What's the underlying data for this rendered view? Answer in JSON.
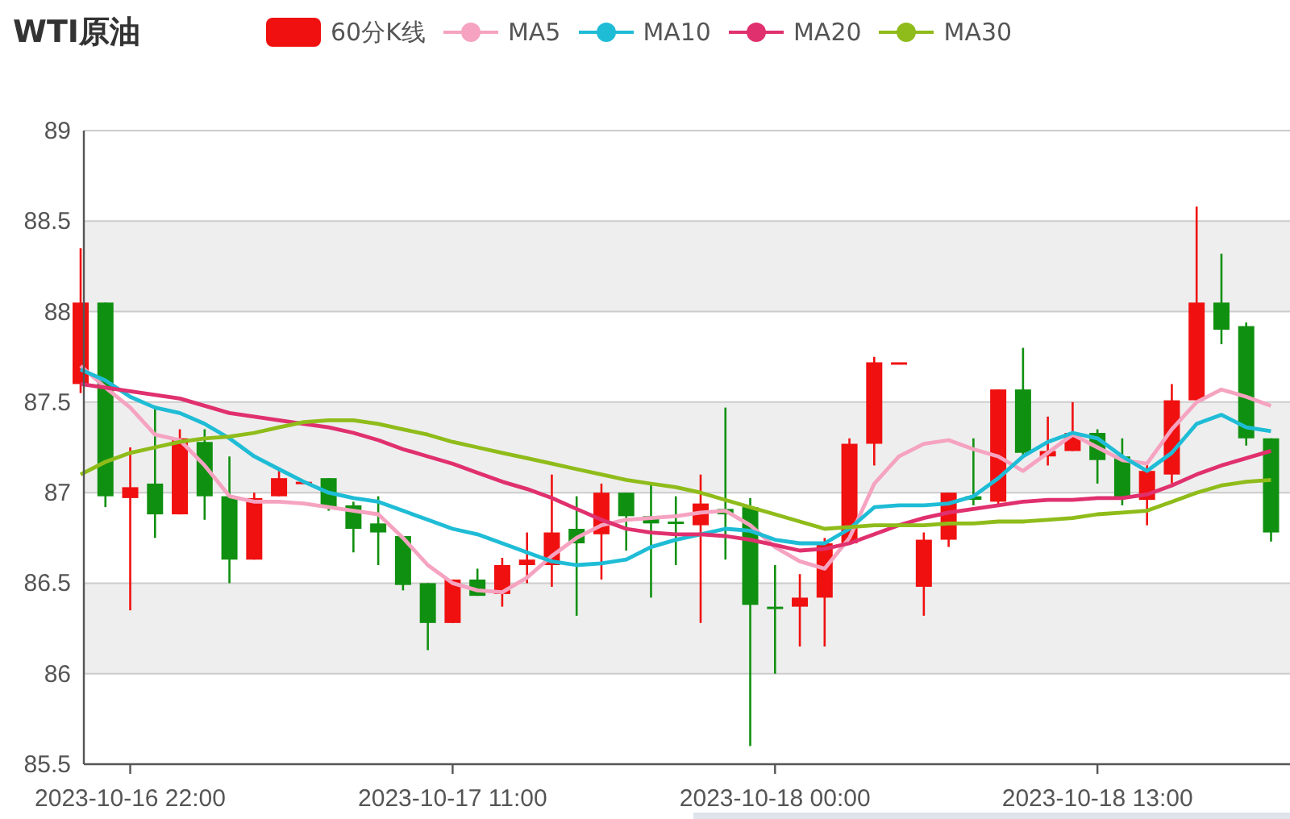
{
  "candle_legend": {
    "label": "60分K线",
    "color": "#f01010"
  },
  "chart_data": {
    "type": "candlestick",
    "title": "WTI原油",
    "ylim": [
      85.5,
      89
    ],
    "yticks": [
      85.5,
      86,
      86.5,
      87,
      87.5,
      88,
      88.5,
      89
    ],
    "grid": true,
    "legend": "top",
    "categories": [
      null,
      null,
      "2023-10-16 22:00",
      null,
      null,
      null,
      null,
      null,
      null,
      null,
      null,
      null,
      null,
      null,
      null,
      "2023-10-17 11:00",
      null,
      null,
      null,
      null,
      null,
      null,
      null,
      null,
      null,
      null,
      null,
      null,
      "2023-10-18 00:00",
      null,
      null,
      null,
      null,
      null,
      null,
      null,
      null,
      null,
      null,
      null,
      null,
      "2023-10-18 13:00",
      null,
      null,
      null,
      null,
      null,
      null,
      null
    ],
    "ohlc": [
      [
        87.6,
        88.35,
        87.55,
        88.05
      ],
      [
        88.05,
        88.05,
        86.92,
        86.98
      ],
      [
        86.97,
        87.25,
        86.35,
        87.03
      ],
      [
        87.05,
        87.48,
        86.75,
        86.88
      ],
      [
        86.88,
        87.35,
        86.88,
        87.3
      ],
      [
        87.28,
        87.35,
        86.85,
        86.98
      ],
      [
        86.98,
        87.2,
        86.5,
        86.63
      ],
      [
        86.63,
        87.0,
        86.63,
        86.97
      ],
      [
        86.98,
        87.12,
        86.98,
        87.08
      ],
      [
        87.05,
        87.06,
        87.05,
        87.06
      ],
      [
        87.08,
        87.08,
        86.9,
        86.92
      ],
      [
        86.93,
        86.95,
        86.67,
        86.8
      ],
      [
        86.83,
        86.98,
        86.6,
        86.78
      ],
      [
        86.76,
        86.76,
        86.46,
        86.49
      ],
      [
        86.5,
        86.5,
        86.13,
        86.28
      ],
      [
        86.28,
        86.52,
        86.28,
        86.52
      ],
      [
        86.52,
        86.58,
        86.43,
        86.43
      ],
      [
        86.44,
        86.64,
        86.37,
        86.6
      ],
      [
        86.6,
        86.78,
        86.5,
        86.63
      ],
      [
        86.6,
        87.1,
        86.48,
        86.78
      ],
      [
        86.8,
        86.98,
        86.32,
        86.72
      ],
      [
        86.77,
        87.05,
        86.52,
        87.0
      ],
      [
        87.0,
        87.0,
        86.68,
        86.87
      ],
      [
        86.87,
        87.05,
        86.42,
        86.83
      ],
      [
        86.84,
        86.98,
        86.6,
        86.83
      ],
      [
        86.82,
        87.1,
        86.28,
        86.94
      ],
      [
        86.91,
        87.47,
        86.63,
        86.88
      ],
      [
        86.92,
        86.97,
        85.6,
        86.38
      ],
      [
        86.37,
        86.6,
        86.0,
        86.36
      ],
      [
        86.37,
        86.55,
        86.15,
        86.42
      ],
      [
        86.42,
        86.75,
        86.15,
        86.72
      ],
      [
        86.72,
        87.3,
        86.72,
        87.27
      ],
      [
        87.27,
        87.75,
        87.15,
        87.72
      ],
      [
        87.72,
        87.72,
        87.72,
        87.72
      ],
      [
        86.48,
        86.78,
        86.32,
        86.74
      ],
      [
        86.74,
        87.0,
        86.7,
        87.0
      ],
      [
        86.98,
        87.3,
        86.93,
        86.96
      ],
      [
        86.95,
        87.57,
        86.92,
        87.57
      ],
      [
        87.57,
        87.8,
        87.2,
        87.22
      ],
      [
        87.2,
        87.42,
        87.15,
        87.23
      ],
      [
        87.23,
        87.5,
        87.23,
        87.33
      ],
      [
        87.33,
        87.35,
        87.05,
        87.18
      ],
      [
        87.2,
        87.3,
        86.93,
        86.97
      ],
      [
        86.96,
        87.16,
        86.82,
        87.12
      ],
      [
        87.1,
        87.6,
        87.05,
        87.51
      ],
      [
        87.51,
        88.58,
        87.51,
        88.05
      ],
      [
        88.05,
        88.32,
        87.82,
        87.9
      ],
      [
        87.92,
        87.94,
        87.26,
        87.3
      ],
      [
        87.3,
        87.3,
        86.73,
        86.78
      ]
    ],
    "series": [
      {
        "name": "MA5",
        "type": "line",
        "color": "#f5a3c0",
        "values": [
          87.7,
          87.58,
          87.47,
          87.32,
          87.29,
          87.15,
          86.98,
          86.95,
          86.95,
          86.94,
          86.92,
          86.9,
          86.88,
          86.75,
          86.6,
          86.5,
          86.46,
          86.45,
          86.53,
          86.65,
          86.75,
          86.82,
          86.85,
          86.86,
          86.87,
          86.89,
          86.9,
          86.82,
          86.7,
          86.62,
          86.58,
          86.75,
          87.05,
          87.2,
          87.27,
          87.29,
          87.24,
          87.2,
          87.12,
          87.22,
          87.32,
          87.25,
          87.18,
          87.16,
          87.35,
          87.5,
          87.57,
          87.53,
          87.48
        ]
      },
      {
        "name": "MA10",
        "type": "line",
        "color": "#1fbcd6",
        "values": [
          87.68,
          87.62,
          87.53,
          87.47,
          87.44,
          87.38,
          87.3,
          87.2,
          87.13,
          87.06,
          87.0,
          86.97,
          86.95,
          86.9,
          86.85,
          86.8,
          86.77,
          86.72,
          86.67,
          86.62,
          86.6,
          86.61,
          86.63,
          86.7,
          86.74,
          86.77,
          86.8,
          86.79,
          86.74,
          86.72,
          86.72,
          86.8,
          86.92,
          86.93,
          86.93,
          86.94,
          86.98,
          87.08,
          87.2,
          87.28,
          87.33,
          87.3,
          87.2,
          87.12,
          87.22,
          87.38,
          87.43,
          87.36,
          87.34
        ]
      },
      {
        "name": "MA20",
        "type": "line",
        "color": "#e0306e",
        "values": [
          87.6,
          87.58,
          87.56,
          87.54,
          87.52,
          87.48,
          87.44,
          87.42,
          87.4,
          87.38,
          87.36,
          87.33,
          87.29,
          87.24,
          87.2,
          87.16,
          87.11,
          87.06,
          87.02,
          86.97,
          86.91,
          86.85,
          86.8,
          86.78,
          86.77,
          86.77,
          86.76,
          86.74,
          86.71,
          86.68,
          86.69,
          86.72,
          86.77,
          86.82,
          86.86,
          86.89,
          86.91,
          86.93,
          86.95,
          86.96,
          86.96,
          86.97,
          86.97,
          86.99,
          87.04,
          87.1,
          87.15,
          87.19,
          87.23
        ]
      },
      {
        "name": "MA30",
        "type": "line",
        "color": "#8fbc1a",
        "values": [
          87.1,
          87.17,
          87.22,
          87.25,
          87.28,
          87.3,
          87.31,
          87.33,
          87.36,
          87.39,
          87.4,
          87.4,
          87.38,
          87.35,
          87.32,
          87.28,
          87.25,
          87.22,
          87.19,
          87.16,
          87.13,
          87.1,
          87.07,
          87.05,
          87.03,
          87.0,
          86.96,
          86.92,
          86.88,
          86.84,
          86.8,
          86.81,
          86.82,
          86.82,
          86.82,
          86.83,
          86.83,
          86.84,
          86.84,
          86.85,
          86.86,
          86.88,
          86.89,
          86.9,
          86.95,
          87.0,
          87.04,
          87.06,
          87.07
        ]
      }
    ]
  }
}
